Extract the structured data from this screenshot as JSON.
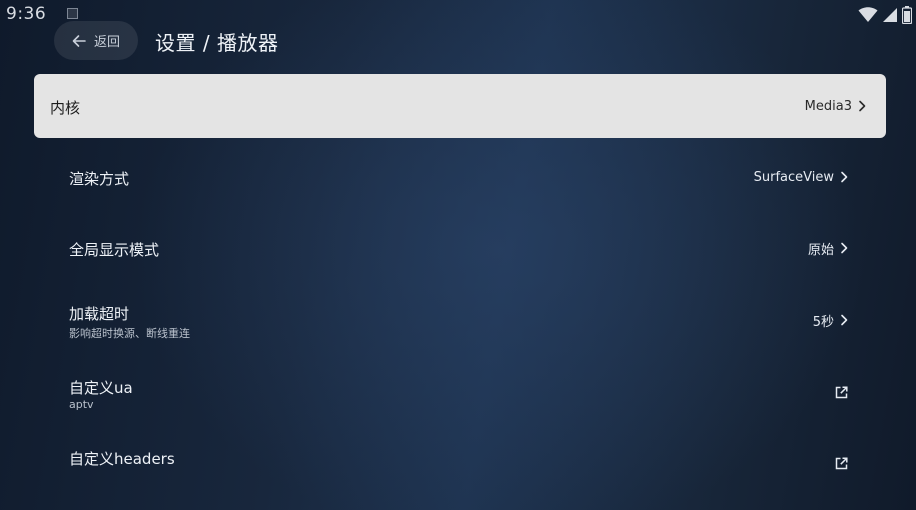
{
  "status_bar": {
    "time": "9:36"
  },
  "header": {
    "back_label": "返回",
    "title": "设置 / 播放器"
  },
  "settings": [
    {
      "title": "内核",
      "subtitle": "",
      "value": "Media3",
      "action": "chevron-right-icon"
    },
    {
      "title": "渲染方式",
      "subtitle": "",
      "value": "SurfaceView",
      "action": "chevron-right-icon"
    },
    {
      "title": "全局显示模式",
      "subtitle": "",
      "value": "原始",
      "action": "chevron-right-icon"
    },
    {
      "title": "加载超时",
      "subtitle": "影响超时换源、断线重连",
      "value": "5秒",
      "action": "chevron-right-icon"
    },
    {
      "title": "自定义ua",
      "subtitle": "aptv",
      "value": "",
      "action": "open-in-new-icon"
    },
    {
      "title": "自定义headers",
      "subtitle": "",
      "value": "",
      "action": "open-in-new-icon"
    }
  ],
  "colors": {
    "background": "#18273d",
    "focused_row": "#e4e4e4",
    "text": "#eef2f7"
  }
}
